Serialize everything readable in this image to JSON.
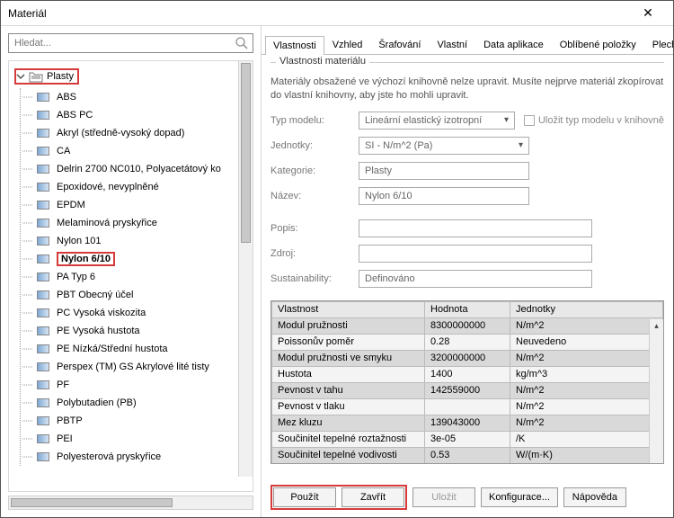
{
  "window": {
    "title": "Materiál"
  },
  "search": {
    "placeholder": "Hledat..."
  },
  "tree": {
    "root": "Plasty",
    "items": [
      {
        "label": "ABS"
      },
      {
        "label": "ABS PC"
      },
      {
        "label": "Akryl (středně-vysoký dopad)"
      },
      {
        "label": "CA"
      },
      {
        "label": "Delrin 2700 NC010, Polyacetátový ko"
      },
      {
        "label": "Epoxidové, nevyplněné"
      },
      {
        "label": "EPDM"
      },
      {
        "label": "Melaminová pryskyřice"
      },
      {
        "label": "Nylon 101"
      },
      {
        "label": "Nylon 6/10",
        "selected": true
      },
      {
        "label": "PA Typ 6"
      },
      {
        "label": "PBT Obecný účel"
      },
      {
        "label": "PC Vysoká viskozita"
      },
      {
        "label": "PE Vysoká hustota"
      },
      {
        "label": "PE Nízká/Střední hustota"
      },
      {
        "label": "Perspex (TM) GS Akrylové lité tisty"
      },
      {
        "label": "PF"
      },
      {
        "label": "Polybutadien (PB)"
      },
      {
        "label": "PBTP"
      },
      {
        "label": "PEI"
      },
      {
        "label": "Polyesterová pryskyřice"
      }
    ]
  },
  "tabs": {
    "items": [
      "Vlastnosti",
      "Vzhled",
      "Šrafování",
      "Vlastní",
      "Data aplikace",
      "Oblíbené položky",
      "Plech"
    ],
    "active": 0
  },
  "group": {
    "title": "Vlastnosti materiálu"
  },
  "hint": "Materiály obsažené ve výchozí knihovně nelze upravit. Musíte nejprve materiál zkopírovat do vlastní knihovny, aby jste ho mohli upravit.",
  "form": {
    "model_type_label": "Typ modelu:",
    "model_type_value": "Lineární elastický izotropní",
    "save_type_label": "Uložit typ modelu v knihovně",
    "units_label": "Jednotky:",
    "units_value": "SI - N/m^2 (Pa)",
    "category_label": "Kategorie:",
    "category_value": "Plasty",
    "name_label": "Název:",
    "name_value": "Nylon 6/10",
    "desc_label": "Popis:",
    "desc_value": "",
    "source_label": "Zdroj:",
    "source_value": "",
    "sust_label": "Sustainability:",
    "sust_value": "Definováno"
  },
  "prop_table": {
    "headers": [
      "Vlastnost",
      "Hodnota",
      "Jednotky"
    ],
    "rows": [
      [
        "Modul pružnosti",
        "8300000000",
        "N/m^2"
      ],
      [
        "Poissonův poměr",
        "0.28",
        "Neuvedeno"
      ],
      [
        "Modul pružnosti ve smyku",
        "3200000000",
        "N/m^2"
      ],
      [
        "Hustota",
        "1400",
        "kg/m^3"
      ],
      [
        "Pevnost v tahu",
        "142559000",
        "N/m^2"
      ],
      [
        "Pevnost v tlaku",
        "",
        "N/m^2"
      ],
      [
        "Mez kluzu",
        "139043000",
        "N/m^2"
      ],
      [
        "Součinitel tepelné roztažnosti",
        "3e-05",
        "/K"
      ],
      [
        "Součinitel tepelné vodivosti",
        "0.53",
        "W/(m·K)"
      ]
    ]
  },
  "buttons": {
    "apply": "Použít",
    "close": "Zavřít",
    "save": "Uložit",
    "config": "Konfigurace...",
    "help": "Nápověda"
  }
}
